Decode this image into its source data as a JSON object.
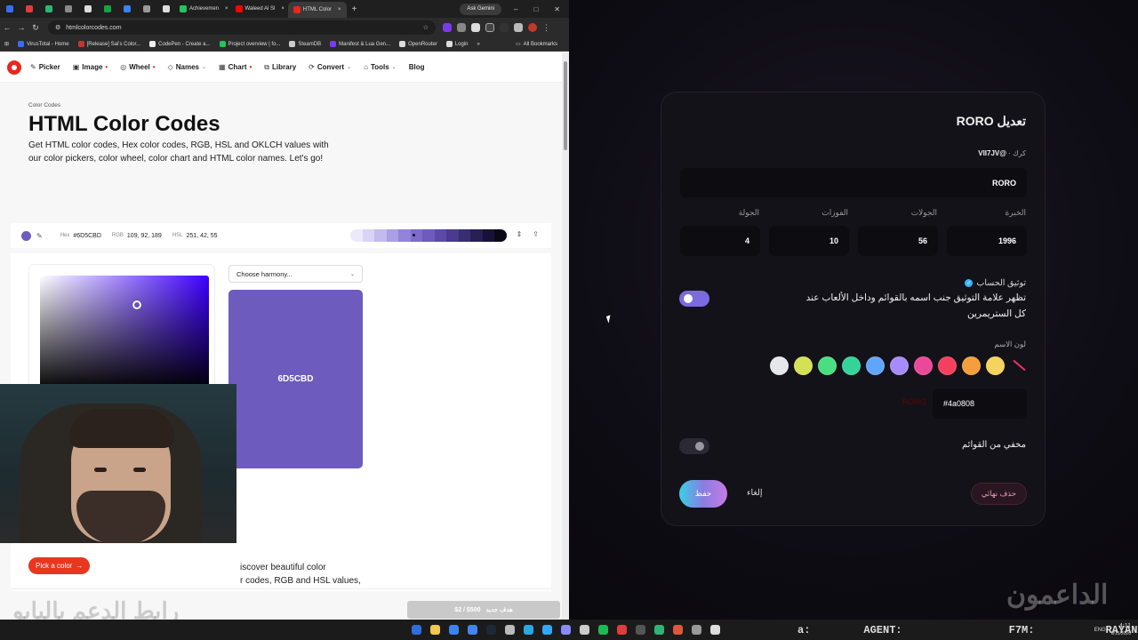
{
  "browser": {
    "tabs": [
      {
        "label": "",
        "color": "#3b6cf6",
        "mini": true
      },
      {
        "label": "",
        "color": "#e23b3b",
        "mini": true
      },
      {
        "label": "",
        "color": "#2bb673",
        "mini": true
      },
      {
        "label": "",
        "color": "#8a8a8a",
        "mini": true
      },
      {
        "label": "",
        "color": "#dddddd",
        "mini": true
      },
      {
        "label": "",
        "color": "#16a34a",
        "mini": true
      },
      {
        "label": "",
        "color": "#3b82f6",
        "mini": true
      },
      {
        "label": "",
        "color": "#999999",
        "mini": true
      },
      {
        "label": "",
        "color": "#dddddd",
        "mini": true
      },
      {
        "label": "Achievemen",
        "color": "#22c55e",
        "mini": false
      },
      {
        "label": "Waleed Al Sl",
        "color": "#ff0000",
        "mini": false
      },
      {
        "label": "HTML Color",
        "color": "#e8261f",
        "mini": false,
        "active": true
      }
    ],
    "ask_gemini": "Ask Gemini",
    "url": "htmlcolorcodes.com",
    "bookmarks": [
      {
        "label": "VirusTotal - Home",
        "color": "#3b6cf6"
      },
      {
        "label": "[Release] Sai's Color...",
        "color": "#c0392b"
      },
      {
        "label": "CodePen - Create a...",
        "color": "#eeeeee"
      },
      {
        "label": "Project overview | fo...",
        "color": "#22c55e"
      },
      {
        "label": "SteamDB",
        "color": "#cccccc"
      },
      {
        "label": "Manifest & Lua Gen...",
        "color": "#7c3aed"
      },
      {
        "label": "OpenRouter",
        "color": "#dddddd"
      },
      {
        "label": "Login",
        "color": "#dddddd"
      }
    ],
    "all_bookmarks": "All Bookmarks"
  },
  "site": {
    "nav": [
      {
        "label": "Picker",
        "icon": "pencil-icon",
        "glyph": "✎",
        "dot": false,
        "chev": false
      },
      {
        "label": "Image",
        "icon": "image-icon",
        "glyph": "▣",
        "dot": true,
        "chev": false
      },
      {
        "label": "Wheel",
        "icon": "wheel-icon",
        "glyph": "◎",
        "dot": true,
        "chev": false
      },
      {
        "label": "Names",
        "icon": "tag-icon",
        "glyph": "◇",
        "dot": false,
        "chev": true
      },
      {
        "label": "Chart",
        "icon": "grid-icon",
        "glyph": "▦",
        "dot": true,
        "chev": false
      },
      {
        "label": "Library",
        "icon": "book-icon",
        "glyph": "⧉",
        "dot": false,
        "chev": false
      },
      {
        "label": "Convert",
        "icon": "convert-icon",
        "glyph": "⟳",
        "dot": false,
        "chev": true
      },
      {
        "label": "Tools",
        "icon": "tools-icon",
        "glyph": "⌂",
        "dot": false,
        "chev": true
      },
      {
        "label": "Blog",
        "icon": "",
        "glyph": "",
        "dot": false,
        "chev": false
      }
    ],
    "breadcrumb": "Color Codes",
    "title": "HTML Color Codes",
    "lead": "Get HTML color codes, Hex color codes, RGB, HSL and OKLCH values with our color pickers, color wheel, color chart and HTML color names. Let's go!",
    "colorbar": {
      "hex_label": "Hex",
      "hex": "#6D5CBD",
      "rgb_label": "RGB",
      "rgb": "109, 92, 189",
      "hsl_label": "HSL",
      "hsl": "251, 42, 55",
      "shades": [
        "#ece9fb",
        "#d9d3f5",
        "#c3baee",
        "#ab9fe5",
        "#9383d9",
        "#7d6cca",
        "#6D5CBD",
        "#5b4aa8",
        "#4a3b8e",
        "#392d72",
        "#281f54",
        "#181238",
        "#0b0818"
      ]
    },
    "harmony_placeholder": "Choose harmony...",
    "swatch_hex": "6D5CBD",
    "desc": "iscover beautiful color\nr codes, RGB and HSL values,",
    "pick_button": "Pick a color",
    "goal": "$2 / $500",
    "goal_label": "هدف جديد",
    "watermark": "رابط الدعم بالبايو"
  },
  "app": {
    "title": "تعديل RORO",
    "sub_prefix": "كرك · ",
    "sub_handle": "@VII7JV",
    "name_value": "RORO",
    "stats": [
      {
        "label": "الخبرة",
        "value": "1996"
      },
      {
        "label": "الجولات",
        "value": "56"
      },
      {
        "label": "الفوزات",
        "value": "10"
      },
      {
        "label": "الجولة",
        "value": "4"
      }
    ],
    "verify_label": "توثيق الحساب",
    "verify_desc": "تظهر علامة التوثيق جنب اسمه بالقوائم وداخل الألعاب عند كل الستريمرين",
    "name_color_label": "لون الاسم",
    "colors": [
      "none",
      "#f4d35e",
      "#f59e3b",
      "#f43f5e",
      "#ec4899",
      "#a78bfa",
      "#60a5fa",
      "#34d399",
      "#4ade80",
      "#d4e157",
      "#e5e7eb"
    ],
    "hex_value": "#4a0808",
    "preview_name": "RORO",
    "hidden_label": "مخفي من القوائم",
    "save": "حفظ",
    "cancel": "إلغاء",
    "delete": "حذف نهائي",
    "watermark": "الداعمون"
  },
  "taskbar": {
    "labels": [
      "a:",
      "AGENT:",
      "F7M:",
      "RAYAN:"
    ],
    "lang": "ENG",
    "time": "4:11",
    "date": "6/15/2026"
  }
}
